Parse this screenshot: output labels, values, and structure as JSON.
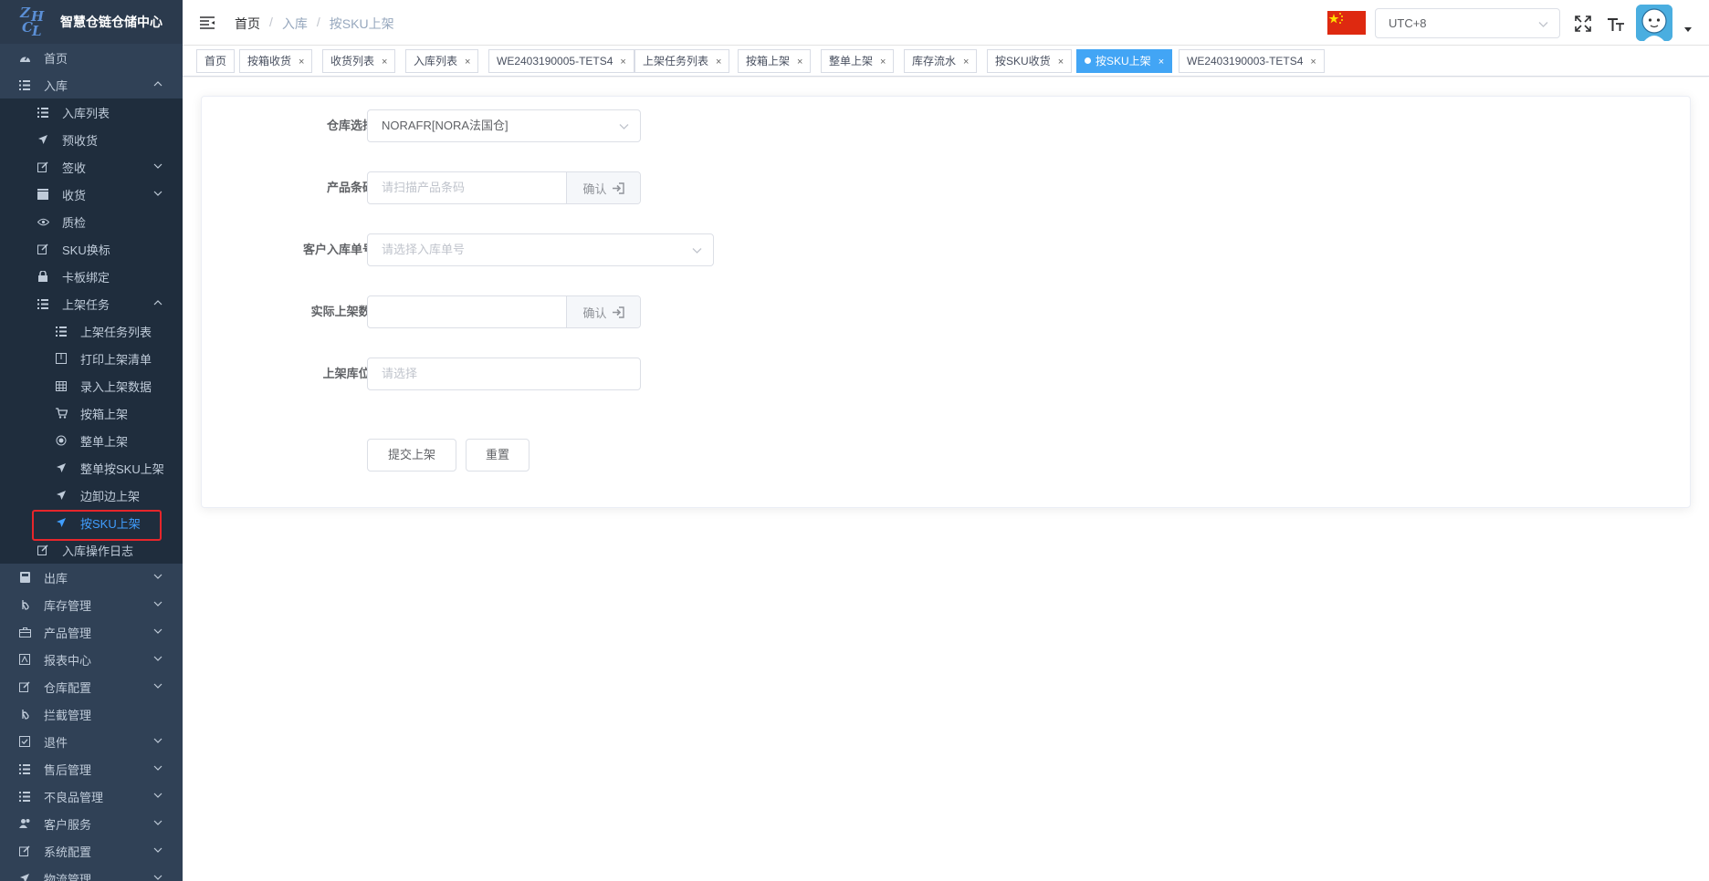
{
  "logo": {
    "letters": [
      "Z",
      "H",
      "C",
      "L"
    ],
    "title": "智慧仓链仓储中心"
  },
  "sidebar": {
    "home": "首页",
    "inbound": "入库",
    "inbound_list": "入库列表",
    "pre_receipt": "预收货",
    "sign": "签收",
    "receive": "收货",
    "qc": "质检",
    "sku_relabel": "SKU换标",
    "pallet_bind": "卡板绑定",
    "putaway_task": "上架任务",
    "putaway_task_list": "上架任务列表",
    "print_putaway_list": "打印上架清单",
    "enter_putaway_data": "录入上架数据",
    "putaway_by_box": "按箱上架",
    "putaway_whole_order": "整单上架",
    "putaway_whole_order_sku": "整单按SKU上架",
    "putaway_unload": "边卸边上架",
    "putaway_by_sku": "按SKU上架",
    "inbound_log": "入库操作日志",
    "outbound": "出库",
    "inventory": "库存管理",
    "products": "产品管理",
    "reports": "报表中心",
    "warehouse_config": "仓库配置",
    "intercept": "拦截管理",
    "returns": "退件",
    "after_sales": "售后管理",
    "defective": "不良品管理",
    "customer_service": "客户服务",
    "system_config": "系统配置",
    "logistics": "物流管理"
  },
  "header": {
    "breadcrumb": [
      "首页",
      "入库",
      "按SKU上架"
    ],
    "timezone": "UTC+8",
    "flag": "china-flag-icon"
  },
  "tags": [
    {
      "label": "首页",
      "closable": false
    },
    {
      "label": "按箱收货",
      "closable": true
    },
    {
      "label": "收货列表",
      "closable": true
    },
    {
      "label": "入库列表",
      "closable": true
    },
    {
      "label": "WE2403190005-TETS4",
      "closable": true
    },
    {
      "label": "上架任务列表",
      "closable": true
    },
    {
      "label": "按箱上架",
      "closable": true
    },
    {
      "label": "整单上架",
      "closable": true
    },
    {
      "label": "库存流水",
      "closable": true
    },
    {
      "label": "按SKU收货",
      "closable": true
    },
    {
      "label": "按SKU上架",
      "closable": true,
      "active": true
    },
    {
      "label": "WE2403190003-TETS4",
      "closable": true
    }
  ],
  "tag_close": "×",
  "form": {
    "warehouse_label": "仓库选择",
    "warehouse_value": "NORAFR[NORA法国仓]",
    "barcode_label": "产品条码",
    "barcode_placeholder": "请扫描产品条码",
    "confirm": "确认",
    "order_label": "客户入库单号",
    "order_placeholder": "请选择入库单号",
    "qty_label": "实际上架数:",
    "qty_value": "",
    "location_label": "上架库位:",
    "location_placeholder": "请选择",
    "submit": "提交上架",
    "reset": "重置"
  },
  "colors": {
    "sidebar_bg": "#304156",
    "submenu_bg": "#1f2d3d",
    "accent": "#409eff",
    "active_tag": "#42a5f5",
    "highlight": "#e6262b"
  }
}
